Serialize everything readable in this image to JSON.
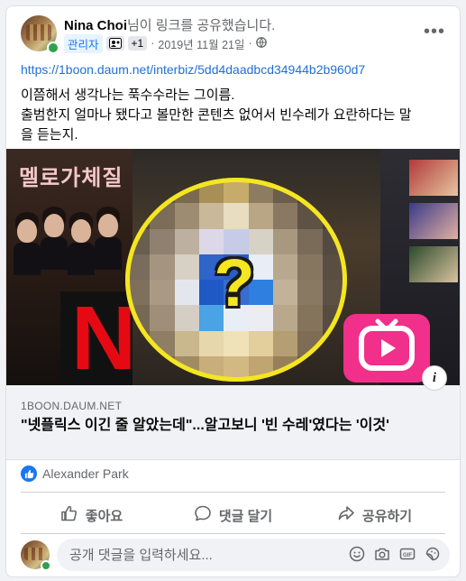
{
  "post": {
    "author_name": "Nina Choi",
    "action_text": "님이 링크를 공유했습니다.",
    "role_badge": "관리자",
    "plus_badge": "+1",
    "date": "2019년 11월 21일",
    "separator": "·",
    "more_label": "•••",
    "link_url": "https://1boon.daum.net/interbiz/5dd4daadbcd34944b2b960d7",
    "text_lines": [
      "이쯤해서 생각나는 푹수수라는 그이름.",
      "출범한지 얼마나 됐다고 볼만한 콘텐츠 없어서 빈수레가 요란하다는 말",
      "을 듣는지."
    ]
  },
  "preview": {
    "poster_title": "멜로가체질",
    "netflix_letter": "N",
    "question_mark": "?",
    "info_label": "i"
  },
  "link_card": {
    "domain": "1BOON.DAUM.NET",
    "title": "\"넷플릭스 이긴 줄 알았는데\"...알고보니 '빈 수레'였다는 '이것'"
  },
  "reactions": {
    "liker": "Alexander Park"
  },
  "actions": {
    "like": "좋아요",
    "comment": "댓글 달기",
    "share": "공유하기"
  },
  "comment_box": {
    "placeholder": "공개 댓글을 입력하세요..."
  },
  "colors": {
    "link_blue": "#1877f2",
    "ring_yellow": "#f4e620",
    "netflix_red": "#e50914",
    "online_green": "#31a24c"
  },
  "icons": [
    "avatar",
    "friends-badge-icon",
    "globe-icon",
    "more-icon",
    "info-icon",
    "like-reaction-icon",
    "like-icon",
    "comment-icon",
    "share-icon",
    "emoji-icon",
    "camera-icon",
    "gif-icon",
    "sticker-icon"
  ]
}
